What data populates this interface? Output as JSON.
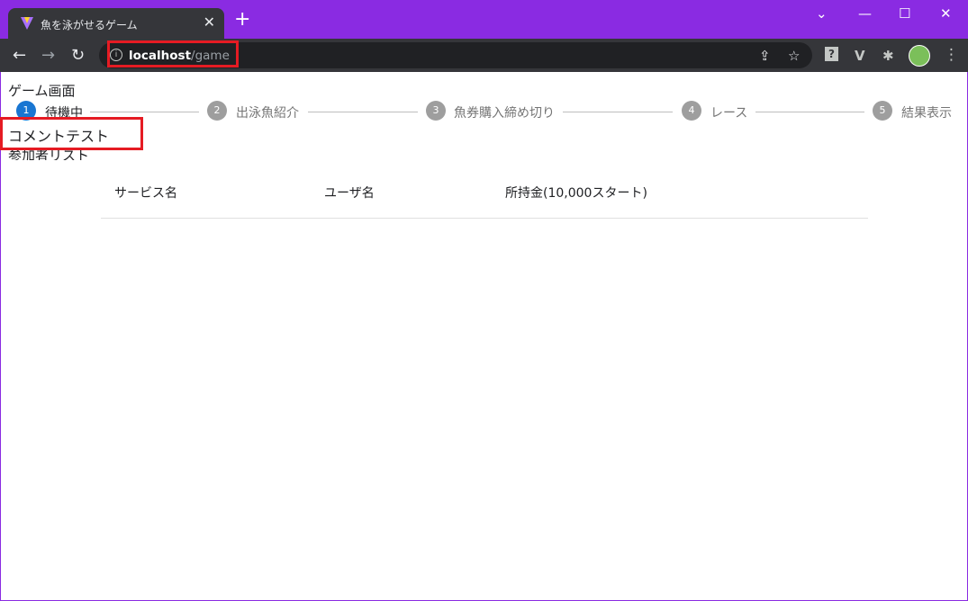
{
  "browser": {
    "tab_title": "魚を泳がせるゲーム",
    "tab_close": "✕",
    "new_tab": "+",
    "window_controls": {
      "dropdown": "⌄",
      "minimize": "—",
      "maximize": "☐",
      "close": "✕"
    },
    "nav": {
      "back": "←",
      "forward": "→",
      "reload": "↻"
    },
    "url_host": "localhost",
    "url_path": "/game",
    "info_icon": "i",
    "share_icon": "⇪",
    "star_icon": "☆",
    "ext1": "?",
    "ext2": "V",
    "ext3": "✱",
    "menu": "⋮"
  },
  "page": {
    "heading": "ゲーム画面",
    "steps": [
      {
        "num": "1",
        "label": "待機中"
      },
      {
        "num": "2",
        "label": "出泳魚紹介"
      },
      {
        "num": "3",
        "label": "魚券購入締め切り"
      },
      {
        "num": "4",
        "label": "レース"
      },
      {
        "num": "5",
        "label": "結果表示"
      }
    ],
    "comment": "コメントテスト",
    "list_heading": "参加者リスト",
    "table_headers": [
      "サービス名",
      "ユーザ名",
      "所持金(10,000スタート)"
    ]
  }
}
